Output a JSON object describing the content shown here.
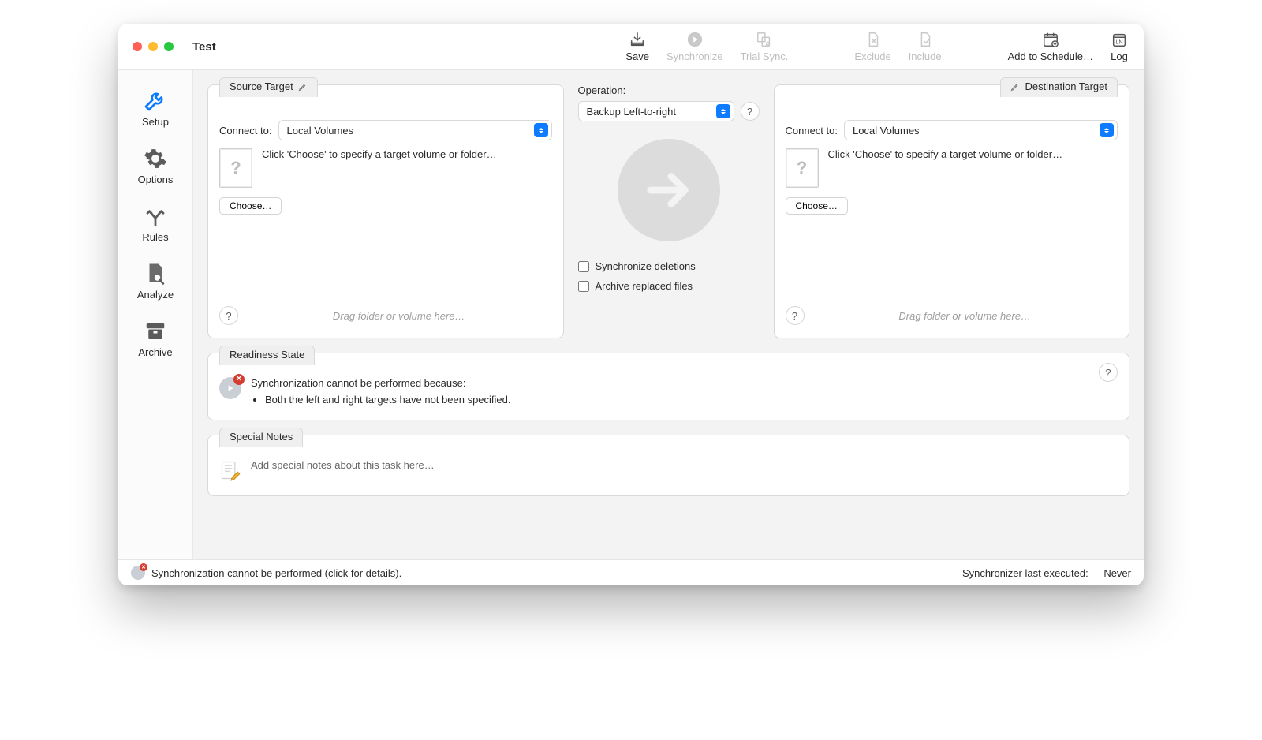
{
  "window_title": "Test",
  "toolbar": {
    "save": "Save",
    "synchronize": "Synchronize",
    "trial_sync": "Trial Sync.",
    "exclude": "Exclude",
    "include": "Include",
    "add_schedule": "Add to Schedule…",
    "log": "Log"
  },
  "sidebar": {
    "setup": "Setup",
    "options": "Options",
    "rules": "Rules",
    "analyze": "Analyze",
    "archive": "Archive"
  },
  "source": {
    "tab_label": "Source Target",
    "connect_label": "Connect to:",
    "connect_value": "Local Volumes",
    "hint": "Click 'Choose' to specify a target volume or folder…",
    "choose_label": "Choose…",
    "drop_hint": "Drag folder or volume here…"
  },
  "operation": {
    "label": "Operation:",
    "value": "Backup Left-to-right",
    "sync_deletions": "Synchronize deletions",
    "archive_replaced": "Archive replaced files"
  },
  "destination": {
    "tab_label": "Destination Target",
    "connect_label": "Connect to:",
    "connect_value": "Local Volumes",
    "hint": "Click 'Choose' to specify a target volume or folder…",
    "choose_label": "Choose…",
    "drop_hint": "Drag folder or volume here…"
  },
  "readiness": {
    "tab_label": "Readiness State",
    "headline": "Synchronization cannot be performed because:",
    "bullet1": "Both the left and right targets have not been specified."
  },
  "notes": {
    "tab_label": "Special Notes",
    "placeholder": "Add special notes about this task here…"
  },
  "status": {
    "message": "Synchronization cannot be performed (click for details).",
    "last_label": "Synchronizer last executed:",
    "last_value": "Never"
  }
}
